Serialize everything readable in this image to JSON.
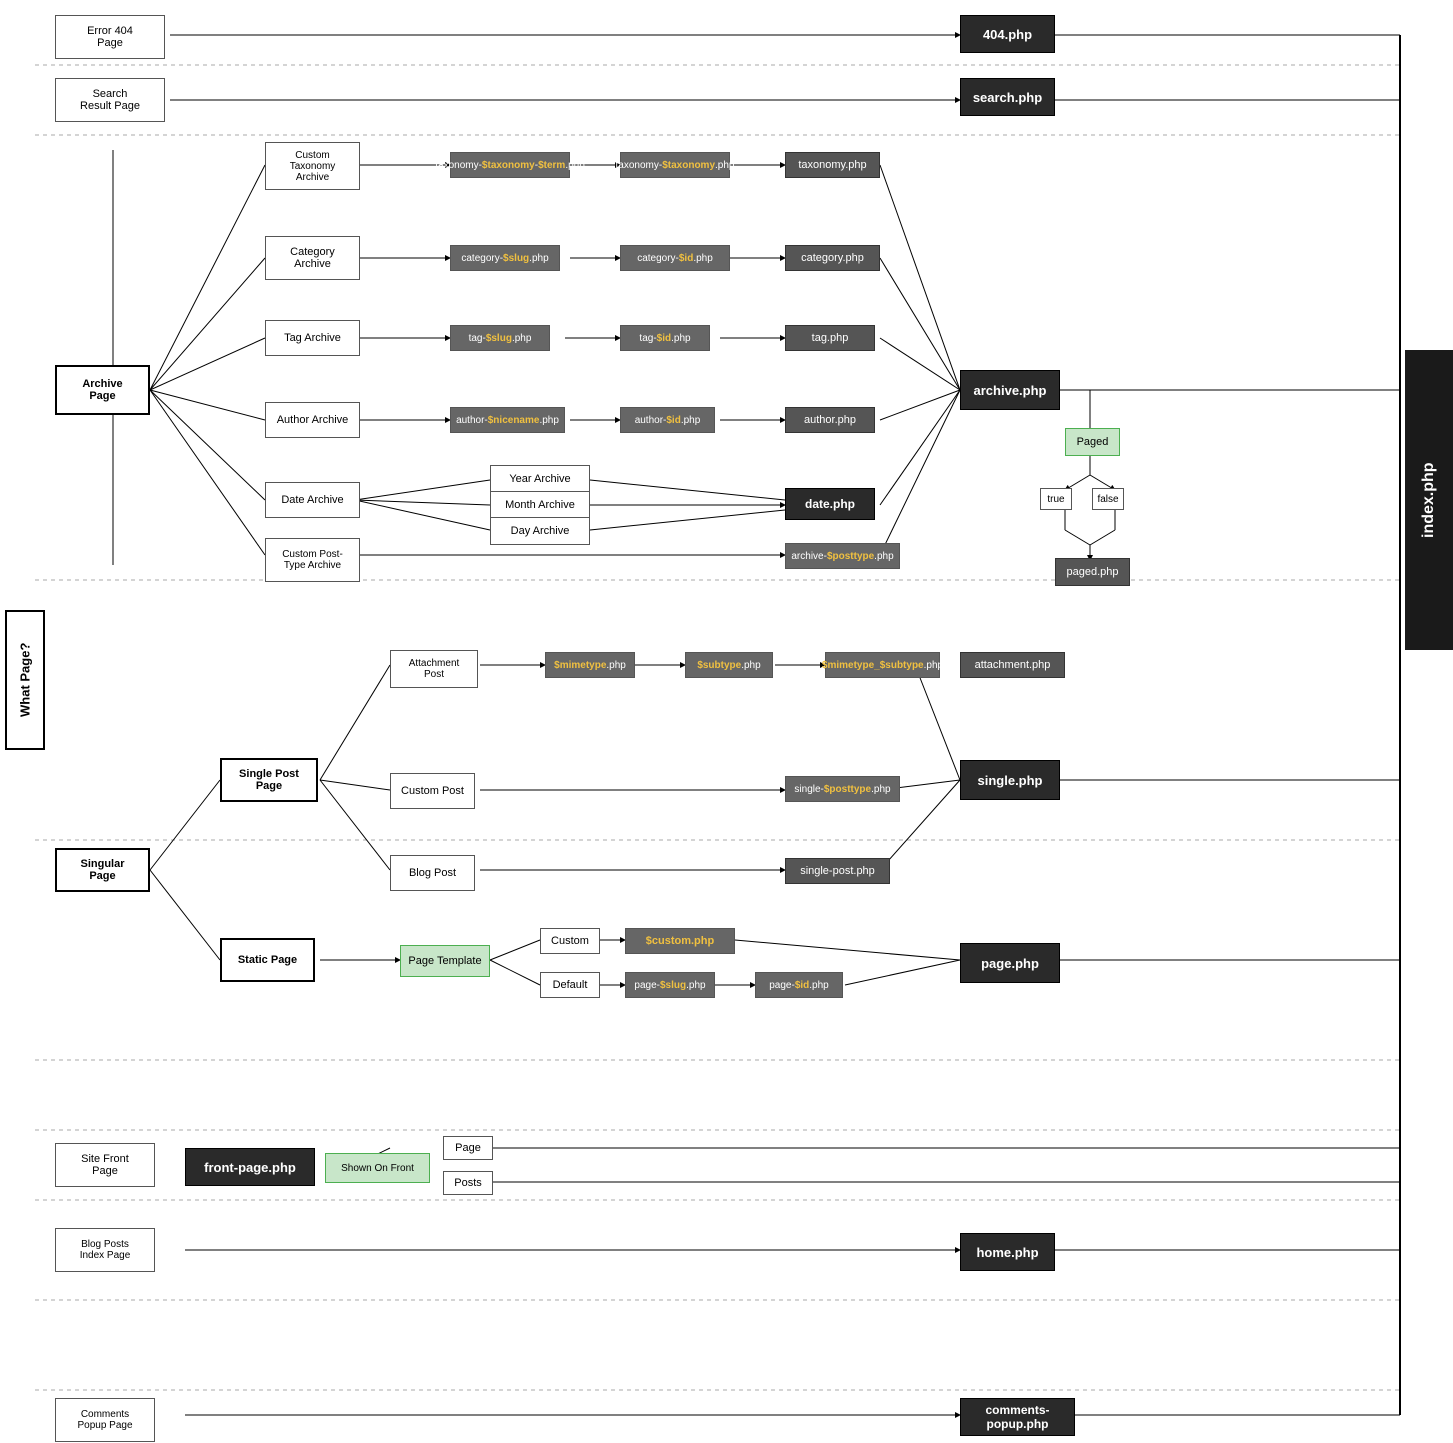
{
  "whatPage": "What Page?",
  "indexPhp": "index.php",
  "sections": {
    "error404": {
      "label": "Error 404\nPage",
      "php": "404.php"
    },
    "searchResult": {
      "label": "Search\nResult Page",
      "php": "search.php"
    },
    "archivePage": {
      "label": "Archive\nPage",
      "php": "archive.php",
      "children": {
        "customTaxonomy": {
          "label": "Custom\nTaxonomy\nArchive",
          "nodes": [
            "taxonomy-$taxonomy-$term.php",
            "taxonomy-$taxonomy.php",
            "taxonomy.php"
          ]
        },
        "categoryArchive": {
          "label": "Category\nArchive",
          "nodes": [
            "category-$slug.php",
            "category-$id.php",
            "category.php"
          ]
        },
        "tagArchive": {
          "label": "Tag Archive",
          "nodes": [
            "tag-$slug.php",
            "tag-$id.php",
            "tag.php"
          ]
        },
        "authorArchive": {
          "label": "Author Archive",
          "nodes": [
            "author-$nicename.php",
            "author-$id.php",
            "author.php"
          ]
        },
        "dateArchive": {
          "label": "Date Archive",
          "subItems": [
            "Year Archive",
            "Month Archive",
            "Day Archive"
          ],
          "php": "date.php"
        },
        "customPostType": {
          "label": "Custom Post-\nType Archive",
          "node": "archive-$posttype.php"
        }
      },
      "paged": {
        "label": "Paged",
        "trueLabel": "true",
        "falseLabel": "false",
        "php": "paged.php"
      }
    },
    "singularPage": {
      "label": "Singular\nPage",
      "children": {
        "singlePostPage": {
          "label": "Single Post\nPage",
          "php": "single.php",
          "children": {
            "attachmentPost": {
              "label": "Attachment\nPost",
              "nodes": [
                "$mimetype.php",
                "$subtype.php",
                "$mimetype_$subtype.php",
                "attachment.php"
              ]
            },
            "customPost": {
              "label": "Custom Post",
              "node": "single-$posttype.php"
            },
            "blogPost": {
              "label": "Blog Post",
              "node": "single-post.php"
            }
          }
        },
        "staticPage": {
          "label": "Static Page",
          "php": "page.php",
          "pageTemplate": {
            "label": "Page Template",
            "custom": {
              "label": "Custom",
              "node": "$custom.php"
            },
            "default": {
              "label": "Default",
              "nodes": [
                "page-$slug.php",
                "page-$id.php"
              ]
            }
          }
        }
      }
    },
    "siteFrontPage": {
      "label": "Site Front\nPage",
      "php": "front-page.php",
      "shownOnFront": "Shown On Front",
      "items": [
        "Page",
        "Posts"
      ]
    },
    "blogPostsIndex": {
      "label": "Blog Posts\nIndex Page",
      "php": "home.php"
    },
    "commentsPopup": {
      "label": "Comments\nPopup Page",
      "php": "comments-popup.php"
    }
  }
}
